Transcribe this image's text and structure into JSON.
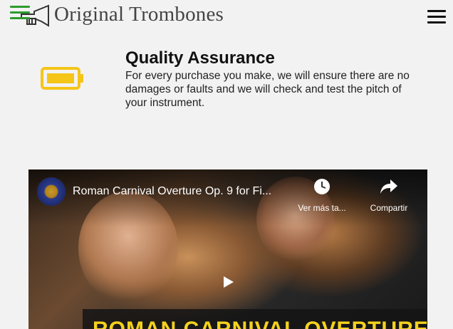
{
  "header": {
    "brand": "Original Trombones",
    "icons": {
      "menu_left": "menu-icon",
      "logo": "trumpet-logo-icon",
      "menu_right": "hamburger-icon"
    }
  },
  "feature": {
    "icon": "battery-icon",
    "title": "Quality Assurance",
    "text": "For every purchase you make, we will ensure there are no damages or faults and we will check and test the pitch of your instrument."
  },
  "video": {
    "title": "Roman Carnival Overture Op. 9 for Fi...",
    "watch_later_label": "Ver más ta...",
    "share_label": "Compartir",
    "caption": "ROMAN CARNIVAL OVERTURE",
    "colors": {
      "caption": "#f4d21c"
    }
  },
  "colors": {
    "accent_green": "#2e9b2e",
    "battery_yellow": "#f5c518"
  }
}
